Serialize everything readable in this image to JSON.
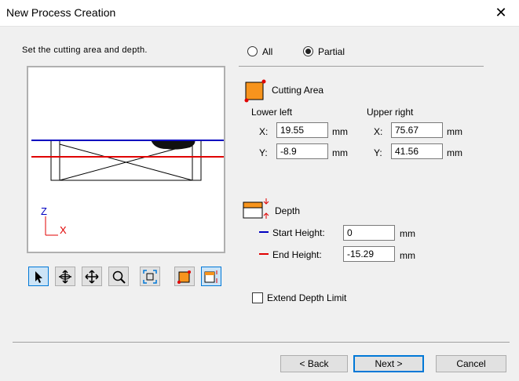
{
  "window": {
    "title": "New Process Creation",
    "close": "✕"
  },
  "instruction": "Set the cutting area and depth.",
  "mode": {
    "all_label": "All",
    "partial_label": "Partial",
    "selected": "Partial"
  },
  "cutting_area": {
    "heading": "Cutting Area",
    "lower_left": {
      "title": "Lower left",
      "x_label": "X:",
      "x_value": "19.55",
      "y_label": "Y:",
      "y_value": "-8.9",
      "unit": "mm"
    },
    "upper_right": {
      "title": "Upper right",
      "x_label": "X:",
      "x_value": "75.67",
      "y_label": "Y:",
      "y_value": "41.56",
      "unit": "mm"
    }
  },
  "depth": {
    "heading": "Depth",
    "start_label": "Start Height:",
    "start_value": "0",
    "end_label": "End Height:",
    "end_value": "-15.29",
    "unit": "mm"
  },
  "preview": {
    "axis_z": "Z",
    "axis_x": "X"
  },
  "toolbar": [
    "select-icon",
    "rotate-icon",
    "pan-icon",
    "zoom-icon",
    "fit-icon",
    "cutting-area-icon",
    "depth-icon"
  ],
  "extend_depth": {
    "label": "Extend Depth Limit",
    "checked": false
  },
  "buttons": {
    "back": "< Back",
    "next": "Next >",
    "cancel": "Cancel"
  },
  "colors": {
    "start_line": "#0000c0",
    "end_line": "#e00000",
    "area_fill": "#f7941d",
    "select_blue": "#0078d7"
  }
}
